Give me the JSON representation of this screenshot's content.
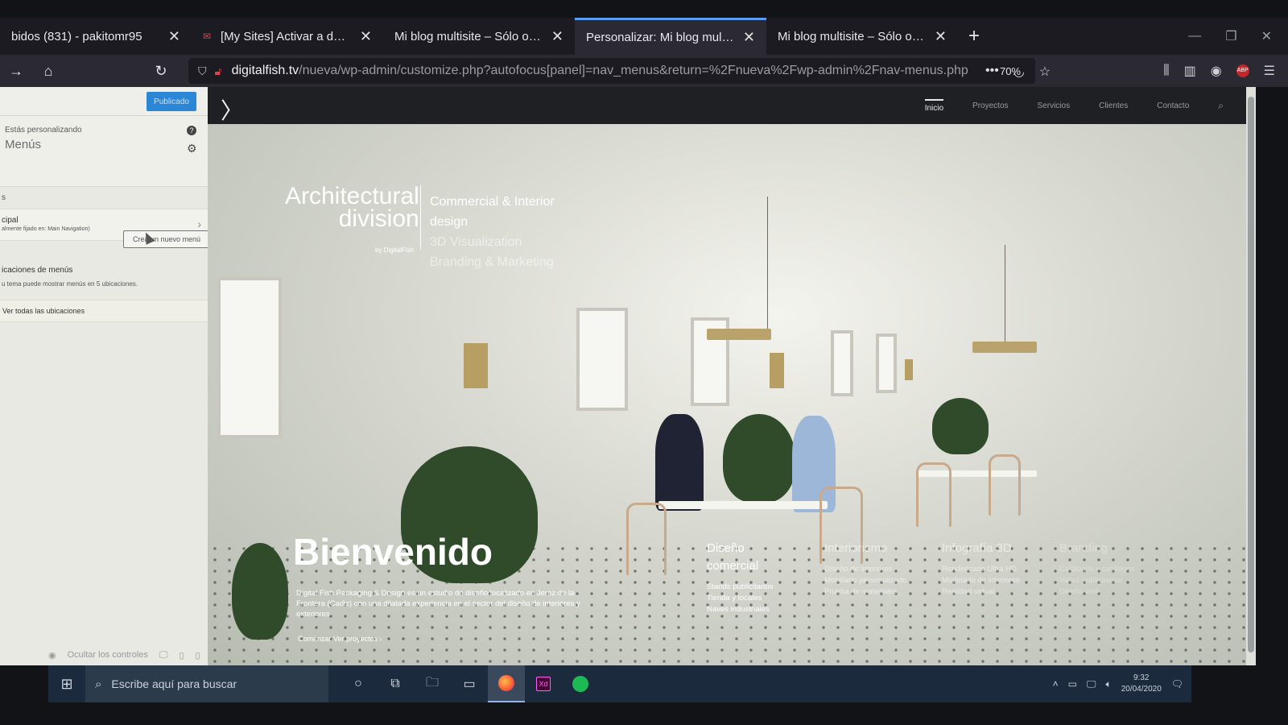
{
  "browser": {
    "tabs": [
      {
        "title": "bidos (831) - pakitomr95",
        "favicon": "mail-icon",
        "active": false
      },
      {
        "title": "[My Sites] Activar a desarollo",
        "favicon": "gmail-icon",
        "active": false
      },
      {
        "title": "Mi blog multisite – Sólo otro sitio",
        "favicon": "",
        "active": false
      },
      {
        "title": "Personalizar: Mi blog multisite – Sólo",
        "favicon": "",
        "active": true
      },
      {
        "title": "Mi blog multisite – Sólo otro sitio",
        "favicon": "",
        "active": false
      }
    ],
    "url_host": "digitalfish.tv",
    "url_path": "/nueva/wp-admin/customize.php?autofocus[panel]=nav_menus&return=%2Fnueva%2Fwp-admin%2Fnav-menus.php",
    "zoom": "70%"
  },
  "customizer": {
    "publish_label": "Publicado",
    "customizing_label": "Estás personalizando",
    "section_title": "Menús",
    "truncated_heading": "s",
    "menu_name": "cipal",
    "menu_location": "almente fijado en: Main Navigation)",
    "new_menu_button": "Crea un nuevo menú",
    "locations_title": "icaciones de menús",
    "locations_desc": "u tema puede mostrar menús en 5 ubicaciones.",
    "view_all_locations": "Ver todas las ubicaciones",
    "footer_label": "Ocultar los controles"
  },
  "site": {
    "nav": [
      "Inicio",
      "Proyectos",
      "Servicios",
      "Clientes",
      "Contacto"
    ],
    "brand_line1": "Architectural",
    "brand_line2": "division",
    "brand_by": "by DigitalFish",
    "services": [
      "Commercial & Interior",
      "design",
      "3D Visualization",
      "Branding & Marketing"
    ],
    "welcome": "Bienvenido",
    "welcome_text": "Digital Fish Packaging & Design es un estudio de diseño localizado en Jerez de la Frontera (Cadiz) con una dilatada experiencia en el sector del diseño de interiores y exteriores",
    "welcome_cta": "Comenzar  Ver proyectos  ›",
    "columns": [
      {
        "title_line1": "Diseño",
        "title_line2": "comercial",
        "items": [
          "Stands publicitarios",
          "Tienda y locales",
          "Naves industriales"
        ]
      },
      {
        "title_line1": "Interiorismo",
        "title_line2": "",
        "items": [
          "Diseño de interiores",
          "Mobiliario personalizado",
          "Prueba de materiales"
        ]
      },
      {
        "title_line1": "Infografía 3D",
        "title_line2": "",
        "items": [
          "Renderizado Ultra HD",
          "Modelado de interiores",
          "Realidad virtual"
        ]
      },
      {
        "title_line1": "Branding",
        "title_line2": "",
        "items": [
          "Catálogos y catálogos",
          "Vallas publicitarias",
          "Diseño web"
        ]
      }
    ]
  },
  "taskbar": {
    "search_placeholder": "Escribe aquí para buscar",
    "time": "9:32",
    "date": "20/04/2020"
  },
  "colors": {
    "accent_tab": "#5b9cf5",
    "publish_button": "#2c86d6",
    "taskbar": "#1b2a3c"
  }
}
